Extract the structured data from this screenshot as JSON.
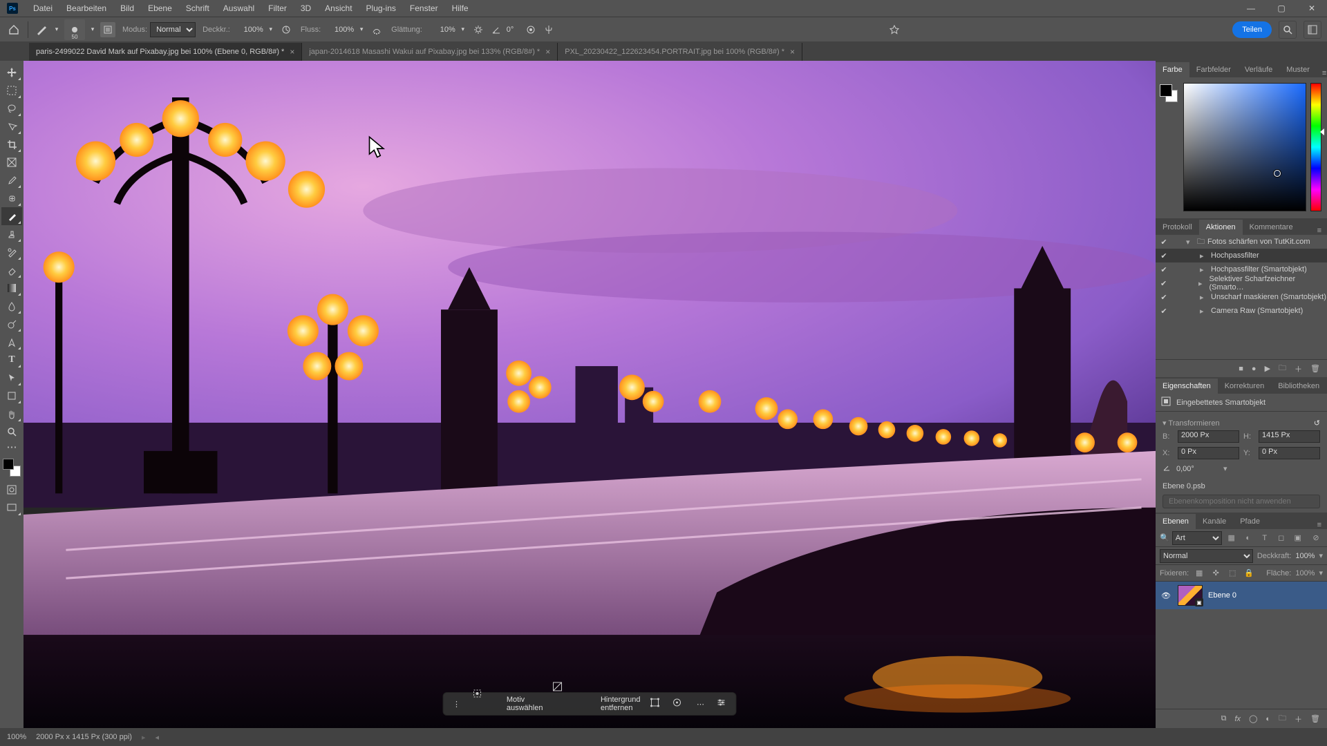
{
  "menu": {
    "logo": "Ps",
    "items": [
      "Datei",
      "Bearbeiten",
      "Bild",
      "Ebene",
      "Schrift",
      "Auswahl",
      "Filter",
      "3D",
      "Ansicht",
      "Plug-ins",
      "Fenster",
      "Hilfe"
    ]
  },
  "optbar": {
    "brush_size": "50",
    "modus_label": "Modus:",
    "modus_value": "Normal",
    "deckkraft_label": "Deckkr.:",
    "deckkraft_value": "100%",
    "fluss_label": "Fluss:",
    "fluss_value": "100%",
    "glaettung_label": "Glättung:",
    "glaettung_value": "10%",
    "angle_icon_label": "",
    "angle_value": "0°",
    "share": "Teilen"
  },
  "tabs": [
    {
      "title": "paris-2499022  David Mark auf Pixabay.jpg bei 100% (Ebene 0, RGB/8#) *",
      "active": true
    },
    {
      "title": "japan-2014618 Masashi Wakui auf Pixabay.jpg bei 133% (RGB/8#) *",
      "active": false
    },
    {
      "title": "PXL_20230422_122623454.PORTRAIT.jpg bei 100% (RGB/8#) *",
      "active": false
    }
  ],
  "floating": {
    "motiv": "Motiv auswählen",
    "hintergrund": "Hintergrund entfernen"
  },
  "color_tabs": [
    "Farbe",
    "Farbfelder",
    "Verläufe",
    "Muster"
  ],
  "actions_tabs": [
    "Protokoll",
    "Aktionen",
    "Kommentare"
  ],
  "actions": {
    "set": "Fotos schärfen von TutKit.com",
    "items": [
      "Hochpassfilter",
      "Hochpassfilter (Smartobjekt)",
      "Selektiver Scharfzeichner (Smarto…",
      "Unscharf maskieren (Smartobjekt)",
      "Camera Raw (Smartobjekt)"
    ]
  },
  "props_tabs": [
    "Eigenschaften",
    "Korrekturen",
    "Bibliotheken"
  ],
  "props": {
    "type": "Eingebettetes Smartobjekt",
    "transform_title": "Transformieren",
    "b_label": "B:",
    "b_val": "2000 Px",
    "h_label": "H:",
    "h_val": "1415 Px",
    "x_label": "X:",
    "x_val": "0 Px",
    "y_label": "Y:",
    "y_val": "0 Px",
    "angle": "0,00°",
    "psb": "Ebene 0.psb",
    "disabled": "Ebenenkomposition nicht anwenden"
  },
  "layers_tabs": [
    "Ebenen",
    "Kanäle",
    "Pfade"
  ],
  "layers": {
    "filter": "Art",
    "blend": "Normal",
    "deckkraft_label": "Deckkraft:",
    "deckkraft_val": "100%",
    "fixieren": "Fixieren:",
    "flaeche_label": "Fläche:",
    "flaeche_val": "100%",
    "layer_name": "Ebene 0"
  },
  "status": {
    "zoom": "100%",
    "dims": "2000 Px x 1415 Px (300 ppi)"
  }
}
